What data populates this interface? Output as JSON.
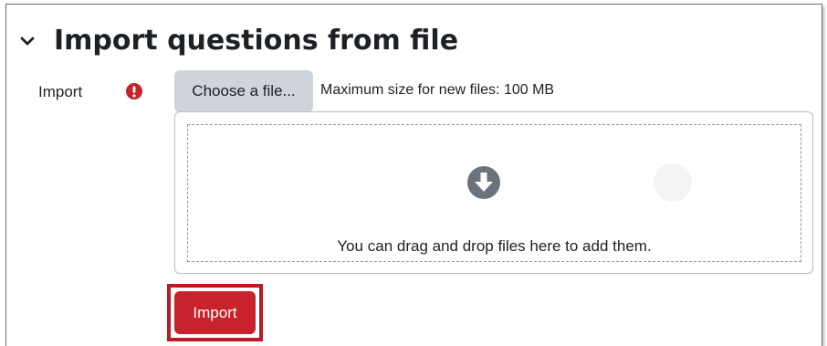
{
  "section": {
    "title": "Import questions from file",
    "collapse_icon": "chevron-down-icon"
  },
  "import_field": {
    "label": "Import",
    "required_icon": "exclamation-circle-icon",
    "choose_button_label": "Choose a file...",
    "max_size_text": "Maximum size for new files: 100 MB"
  },
  "dropzone": {
    "icon": "arrow-down-circle-icon",
    "text": "You can drag and drop files here to add them."
  },
  "actions": {
    "import_button_label": "Import"
  },
  "colors": {
    "primary": "#c8232c",
    "required": "#c8232c",
    "secondary_button": "#ced4da",
    "highlight": "#b71c24"
  }
}
